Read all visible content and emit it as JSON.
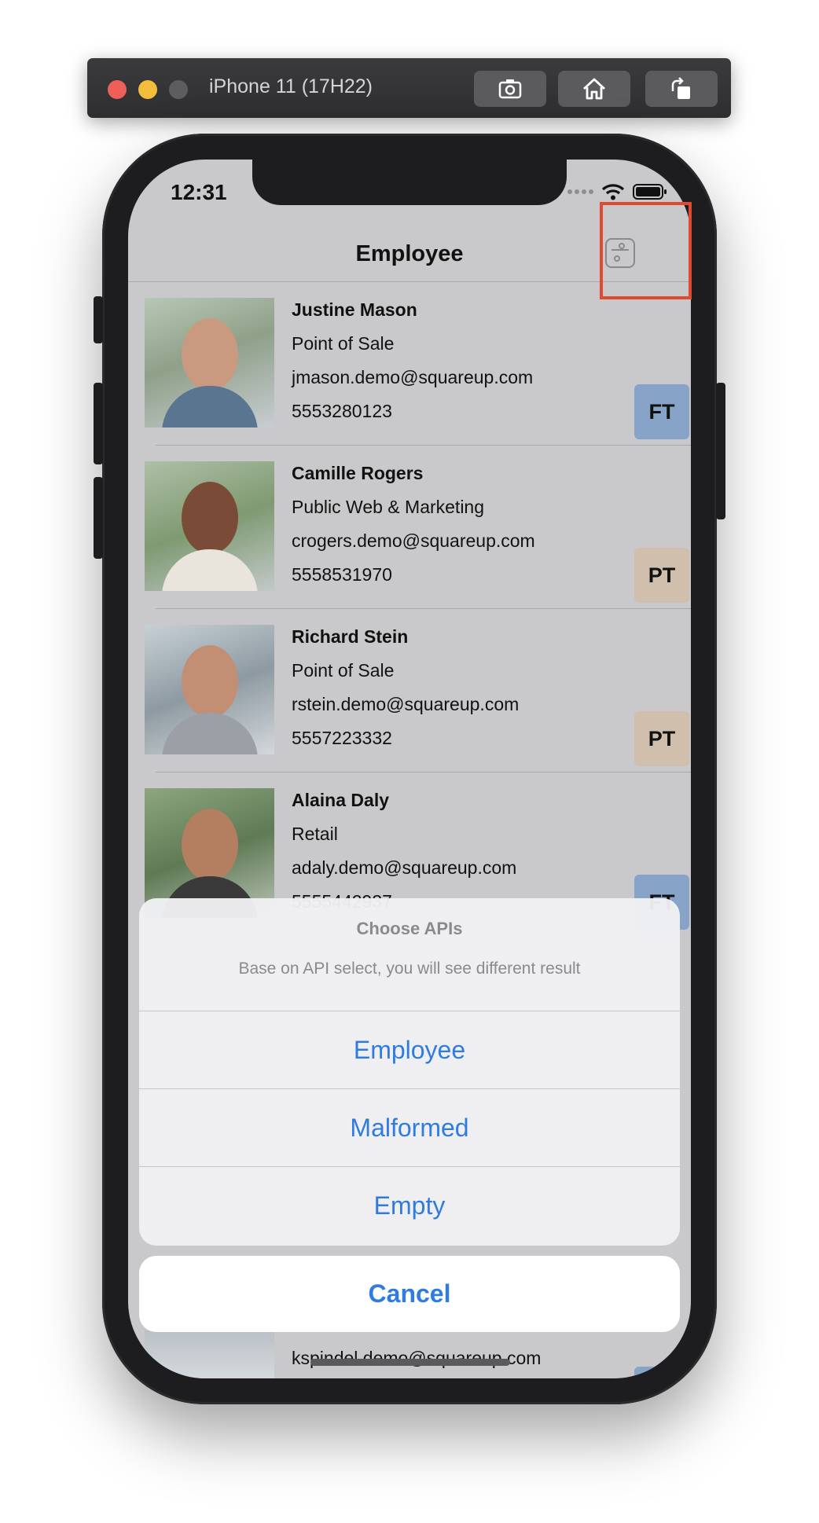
{
  "simulator": {
    "device_title": "iPhone 11 (17H22)",
    "buttons": [
      "screenshot-icon",
      "home-icon",
      "rotate-icon"
    ]
  },
  "status_bar": {
    "time": "12:31"
  },
  "nav": {
    "title": "Employee",
    "action_icon": "toggle-icon"
  },
  "employees": [
    {
      "name": "Justine Mason",
      "team": "Point of Sale",
      "email": "jmason.demo@squareup.com",
      "phone": "5553280123",
      "type": "FT"
    },
    {
      "name": "Camille Rogers",
      "team": "Public Web & Marketing",
      "email": "crogers.demo@squareup.com",
      "phone": "5558531970",
      "type": "PT"
    },
    {
      "name": "Richard Stein",
      "team": "Point of Sale",
      "email": "rstein.demo@squareup.com",
      "phone": "5557223332",
      "type": "PT"
    },
    {
      "name": "Alaina Daly",
      "team": "Retail",
      "email": "adaly.demo@squareup.com",
      "phone": "5555442937",
      "type": "FT"
    }
  ],
  "bottom_row": {
    "email": "kspindel.demo@squareup.com"
  },
  "action_sheet": {
    "title": "Choose APIs",
    "message": "Base on API select, you will see different result",
    "options": [
      "Employee",
      "Malformed",
      "Empty"
    ],
    "cancel": "Cancel"
  },
  "colors": {
    "accent": "#2f7ce0",
    "ft_badge": "#87a4c8",
    "pt_badge": "#d1bfae",
    "highlight": "#e04a30"
  }
}
